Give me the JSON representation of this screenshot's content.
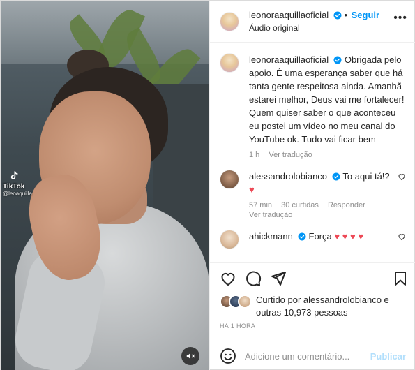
{
  "video": {
    "watermark_brand": "TikTok",
    "watermark_handle": "@leoaquilla",
    "mute_icon": "speaker-muted-icon"
  },
  "header": {
    "username": "leonoraaquillaoficial",
    "follow_separator": "•",
    "follow_label": "Seguir",
    "audio_label": "Áudio original",
    "more_label": "•••"
  },
  "caption": {
    "username": "leonoraaquillaoficial",
    "text": "Obrigada pelo apoio. É uma esperança saber que há tanta gente respeitosa ainda. Amanhã estarei melhor, Deus vai me fortalecer! Quem quiser saber o que aconteceu eu postei um vídeo no meu canal do YouTube ok. Tudo vai ficar bem",
    "time": "1 h",
    "translate": "Ver tradução"
  },
  "comments": [
    {
      "username": "alessandrolobianco",
      "text": "To aqui tá!?",
      "text2": "♥",
      "time": "57 min",
      "likes": "30 curtidas",
      "reply": "Responder",
      "translate": "Ver tradução"
    },
    {
      "username": "ahickmann",
      "text": "Força",
      "hearts": "♥ ♥ ♥ ♥"
    }
  ],
  "likes": {
    "text": "Curtido por alessandrolobianco e outras 10,973 pessoas"
  },
  "timestamp": "Há 1 hora",
  "add_comment": {
    "placeholder": "Adicione um comentário...",
    "post_label": "Publicar"
  },
  "colors": {
    "accent": "#0095f6",
    "heart": "#ed4956",
    "muted_text": "#8e8e8e",
    "post_disabled": "#b2dffc"
  }
}
